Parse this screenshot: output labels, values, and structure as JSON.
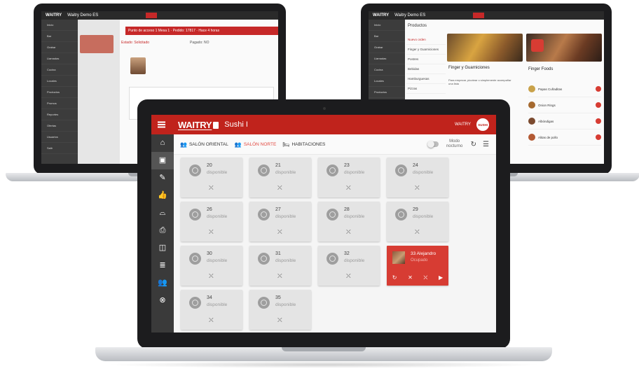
{
  "back_left": {
    "brand": "WAITRY",
    "title": "Waitry Demo ES",
    "order_header": "Punto de acceso 1 Mesa 1 · Pedido: 17817 · Hace 4 horas",
    "status_label": "Estado: Solicitado",
    "paid_label": "Pagado: NO",
    "sidebar": [
      "Inicio",
      "Bar",
      "Grabar",
      "Llamadas",
      "Cocina",
      "Locales",
      "Productos",
      "Promos",
      "Reportes",
      "Ofertas",
      "Usuarios",
      "Salir"
    ]
  },
  "back_right": {
    "brand": "WAITRY",
    "title": "Waitry Demo ES",
    "section": "Productos",
    "categories": [
      "Nuevo orden",
      "Finger y Guarniciones",
      "Postres",
      "Bebidas",
      "Hamburguesas",
      "Pizzas"
    ],
    "card_title": "Finger y Guarniciones",
    "card_desc": "Para empezar, picotear o simplemente acompañar una lista",
    "list_title": "Finger Foods",
    "items": [
      "Papas Cuñaditas",
      "Onion Rings",
      "Albóndigas",
      "Alitas de pollo"
    ],
    "sidebar": [
      "Inicio",
      "Bar",
      "Grabar",
      "Llamadas",
      "Cocina",
      "Locales",
      "Productos",
      "Promos"
    ]
  },
  "front": {
    "brand": "WAITRY",
    "restaurant": "Sushi I",
    "user_label": "WAITRY",
    "avatar_text": "SUSHI",
    "tabs": [
      {
        "label": "SALÓN ORIENTAL",
        "icon": "people-icon",
        "glyph": "👥",
        "active": false
      },
      {
        "label": "SALÓN NORTE",
        "icon": "people-icon",
        "glyph": "👥",
        "active": true
      },
      {
        "label": "HABITACIONES",
        "icon": "bed-icon",
        "glyph": "🛏",
        "active": false
      }
    ],
    "night_mode_label": "Modo nocturno",
    "sidebar": [
      {
        "icon": "home-icon",
        "glyph": "⌂"
      },
      {
        "icon": "tables-icon",
        "glyph": "▣"
      },
      {
        "icon": "pencil-icon",
        "glyph": "✎"
      },
      {
        "icon": "thumb-up-icon",
        "glyph": "👍"
      },
      {
        "icon": "cloche-icon",
        "glyph": "⌓"
      },
      {
        "icon": "printer-icon",
        "glyph": "⎙"
      },
      {
        "icon": "book-icon",
        "glyph": "◫"
      },
      {
        "icon": "database-icon",
        "glyph": "≣"
      },
      {
        "icon": "users-icon",
        "glyph": "👥"
      },
      {
        "icon": "logout-icon",
        "glyph": "⊗"
      }
    ],
    "tables": [
      {
        "number": "20",
        "status": "disponible"
      },
      {
        "number": "21",
        "status": "disponible"
      },
      {
        "number": "23",
        "status": "disponible"
      },
      {
        "number": "24",
        "status": "disponible"
      },
      {
        "number": "26",
        "status": "disponible"
      },
      {
        "number": "27",
        "status": "disponible"
      },
      {
        "number": "28",
        "status": "disponible"
      },
      {
        "number": "29",
        "status": "disponible"
      },
      {
        "number": "30",
        "status": "disponible"
      },
      {
        "number": "31",
        "status": "disponible"
      },
      {
        "number": "32",
        "status": "disponible"
      },
      {
        "number": "33",
        "status": "ocupada",
        "occupied": true,
        "name": "33 Alejandro",
        "sub": "Ocupado"
      },
      {
        "number": "34",
        "status": "disponible"
      },
      {
        "number": "35",
        "status": "disponible"
      }
    ],
    "table_action_glyph": "⛌",
    "occupied_actions": [
      "↻",
      "✕",
      "⛌",
      "▶"
    ],
    "colors": {
      "brand_red": "#c0231c",
      "occupied": "#d73c33",
      "sidebar": "#3a3a3a"
    }
  }
}
